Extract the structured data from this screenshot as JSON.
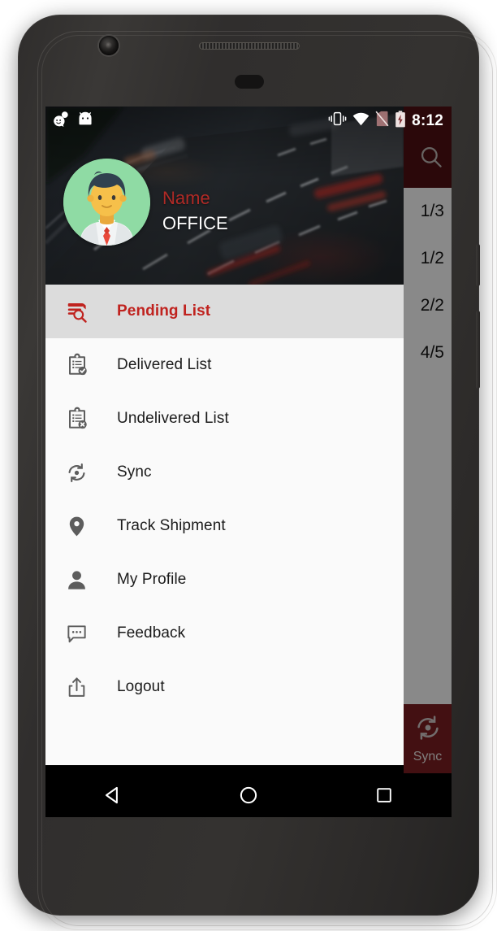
{
  "device": {
    "name": "android-phone",
    "hardware": {
      "front_camera": "front-camera",
      "earpiece": "earpiece-speaker",
      "proximity_sensor": "proximity-sensor",
      "power_button": "power-button",
      "volume_button": "volume-button"
    }
  },
  "colors": {
    "brand_red": "#b02a26",
    "appbar_red": "#5c1317",
    "fab_red": "#7a1e22",
    "active_item_text": "#c0231f",
    "active_item_bg": "#dcdcdc",
    "drawer_bg": "#fafafa",
    "scrim": "rgba(0,0,0,.45)",
    "nav_bar_bg": "#000000",
    "avatar_bg": "#8fdba4"
  },
  "status_bar": {
    "left_icons": [
      {
        "name": "message-smiley-icon",
        "glyph": "message-smiley"
      },
      {
        "name": "android-head-icon",
        "glyph": "android-head"
      }
    ],
    "right_icons": [
      {
        "name": "vibrate-icon",
        "glyph": "vibrate"
      },
      {
        "name": "wifi-icon",
        "glyph": "wifi"
      },
      {
        "name": "no-sim-icon",
        "glyph": "no-sim"
      },
      {
        "name": "battery-charging-icon",
        "glyph": "battery-charging"
      }
    ],
    "clock": "8:12"
  },
  "drawer": {
    "header": {
      "background": "highway-night-photo",
      "avatar": "user-avatar-illustration",
      "name": "Name",
      "office": "OFFICE"
    },
    "items": [
      {
        "label": "Pending List",
        "icon": "pending-list-icon",
        "active": true
      },
      {
        "label": "Delivered List",
        "icon": "delivered-list-icon",
        "active": false
      },
      {
        "label": "Undelivered List",
        "icon": "undelivered-list-icon",
        "active": false
      },
      {
        "label": "Sync",
        "icon": "sync-icon",
        "active": false
      },
      {
        "label": "Track Shipment",
        "icon": "location-pin-icon",
        "active": false
      },
      {
        "label": "My Profile",
        "icon": "person-icon",
        "active": false
      },
      {
        "label": "Feedback",
        "icon": "chat-bubble-icon",
        "active": false
      },
      {
        "label": "Logout",
        "icon": "logout-share-icon",
        "active": false
      }
    ]
  },
  "content": {
    "appbar": {
      "search_icon": "search-icon"
    },
    "rows": [
      {
        "value": "1/3"
      },
      {
        "value": "1/2"
      },
      {
        "value": "2/2"
      },
      {
        "value": "4/5"
      }
    ],
    "sync_button": {
      "label": "Sync",
      "icon": "sync-refresh-icon"
    }
  },
  "nav_bar": {
    "buttons": [
      {
        "name": "back-button",
        "glyph": "triangle-left"
      },
      {
        "name": "home-button",
        "glyph": "circle"
      },
      {
        "name": "recents-button",
        "glyph": "square"
      }
    ]
  }
}
